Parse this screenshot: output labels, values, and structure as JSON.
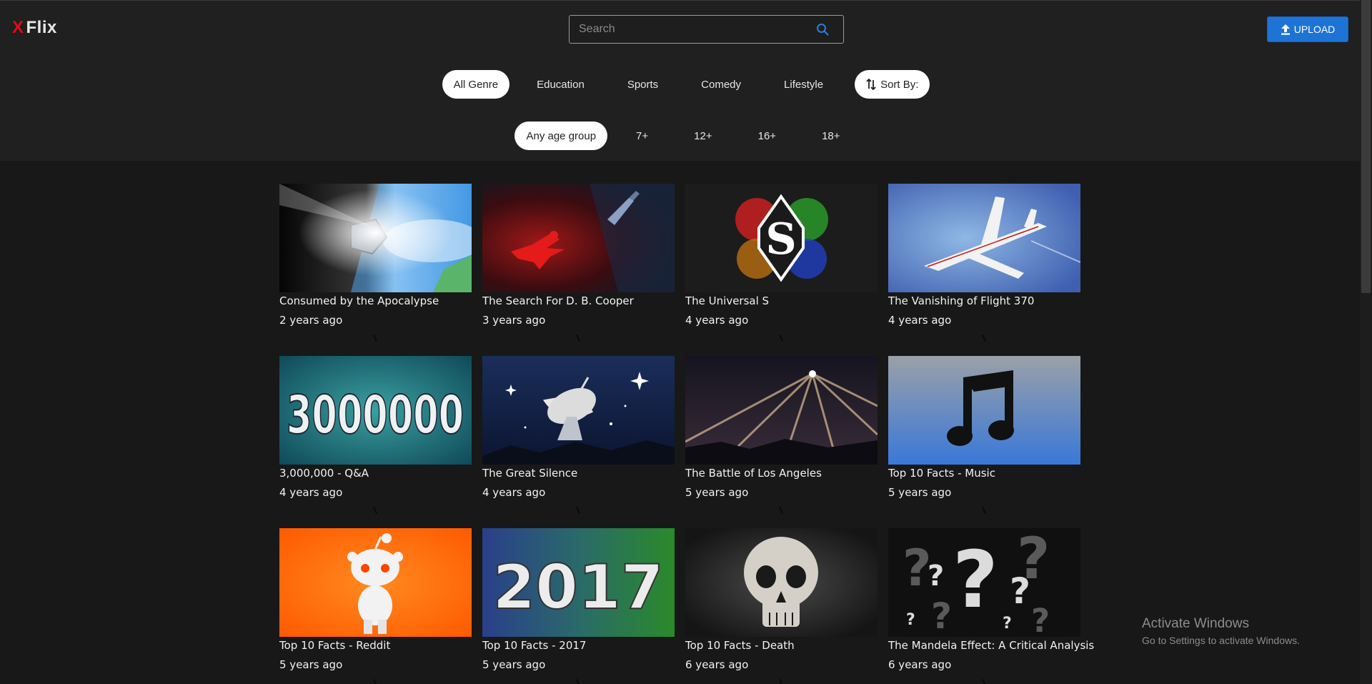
{
  "app": {
    "logo_mark": "X",
    "logo_name": "Flix"
  },
  "search": {
    "placeholder": "Search",
    "value": ""
  },
  "upload": {
    "label": "UPLOAD"
  },
  "genres": [
    {
      "label": "All Genre",
      "active": true
    },
    {
      "label": "Education",
      "active": false
    },
    {
      "label": "Sports",
      "active": false
    },
    {
      "label": "Comedy",
      "active": false
    },
    {
      "label": "Lifestyle",
      "active": false
    }
  ],
  "sort": {
    "label": "Sort By:"
  },
  "ages": [
    {
      "label": "Any age group",
      "active": true
    },
    {
      "label": "7+",
      "active": false
    },
    {
      "label": "12+",
      "active": false
    },
    {
      "label": "16+",
      "active": false
    },
    {
      "label": "18+",
      "active": false
    }
  ],
  "videos": [
    {
      "title": "Consumed by the Apocalypse",
      "age": "2 years ago"
    },
    {
      "title": "The Search For D. B. Cooper",
      "age": "3 years ago"
    },
    {
      "title": "The Universal S",
      "age": "4 years ago"
    },
    {
      "title": "The Vanishing of Flight 370",
      "age": "4 years ago"
    },
    {
      "title": "3,000,000 - Q&A",
      "age": "4 years ago"
    },
    {
      "title": "The Great Silence",
      "age": "4 years ago"
    },
    {
      "title": "The Battle of Los Angeles",
      "age": "5 years ago"
    },
    {
      "title": "Top 10 Facts - Music",
      "age": "5 years ago"
    },
    {
      "title": "Top 10 Facts - Reddit",
      "age": "5 years ago"
    },
    {
      "title": "Top 10 Facts - 2017",
      "age": "5 years ago"
    },
    {
      "title": "Top 10 Facts - Death",
      "age": "6 years ago"
    },
    {
      "title": "The Mandela Effect: A Critical Analysis",
      "age": "6 years ago"
    }
  ],
  "thumb_text": {
    "v5": "3000000",
    "v7": "S",
    "v10": "2017",
    "v12": "?"
  },
  "watermark": {
    "line1": "Activate Windows",
    "line2": "Go to Settings to activate Windows."
  },
  "colors": {
    "brand_red": "#e50914",
    "upload_blue": "#1e74d6",
    "header_bg": "#202020",
    "page_bg": "#181818"
  }
}
